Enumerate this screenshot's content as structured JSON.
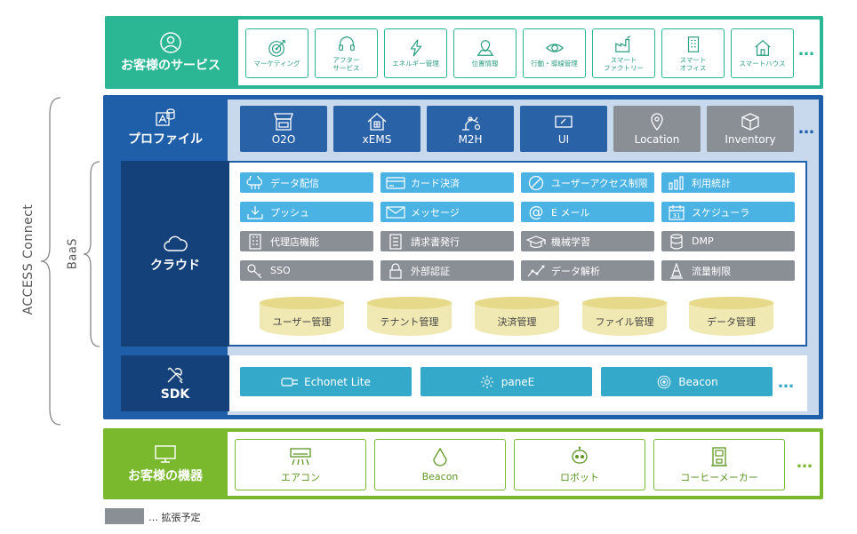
{
  "left_labels": {
    "outer": "ACCESS Connect",
    "inner": "BaaS"
  },
  "services": {
    "title": "お客様のサービス",
    "items": [
      {
        "label": "マーケティング",
        "icon": "target-icon"
      },
      {
        "label": "アフター\nサービス",
        "icon": "headset-icon"
      },
      {
        "label": "エネルギー管理",
        "icon": "bolt-icon"
      },
      {
        "label": "位置情報",
        "icon": "map-pin-icon"
      },
      {
        "label": "行動・導線管理",
        "icon": "eye-icon"
      },
      {
        "label": "スマート\nファクトリー",
        "icon": "factory-icon"
      },
      {
        "label": "スマート\nオフィス",
        "icon": "building-icon"
      },
      {
        "label": "スマートハウス",
        "icon": "house-icon"
      }
    ],
    "more": "…"
  },
  "profile": {
    "title": "プロファイル",
    "items": [
      {
        "label": "O2O",
        "icon": "store-icon",
        "planned": false
      },
      {
        "label": "xEMS",
        "icon": "home-energy-icon",
        "planned": false
      },
      {
        "label": "M2H",
        "icon": "robot-arm-icon",
        "planned": false
      },
      {
        "label": "UI",
        "icon": "ui-panel-icon",
        "planned": false
      },
      {
        "label": "Location",
        "icon": "location-icon",
        "planned": true
      },
      {
        "label": "Inventory",
        "icon": "box-icon",
        "planned": true
      }
    ],
    "more": "…"
  },
  "cloud": {
    "title": "クラウド",
    "features": [
      {
        "label": "データ配信",
        "icon": "cloud-share-icon",
        "planned": false
      },
      {
        "label": "カード決済",
        "icon": "credit-card-icon",
        "planned": false
      },
      {
        "label": "ユーザーアクセス制限",
        "icon": "block-icon",
        "planned": false
      },
      {
        "label": "利用統計",
        "icon": "bar-chart-icon",
        "planned": false
      },
      {
        "label": "プッシュ",
        "icon": "download-icon",
        "planned": false
      },
      {
        "label": "メッセージ",
        "icon": "envelope-icon",
        "planned": false
      },
      {
        "label": "E メール",
        "icon": "at-icon",
        "planned": false
      },
      {
        "label": "スケジューラ",
        "icon": "calendar-icon",
        "planned": false
      },
      {
        "label": "代理店機能",
        "icon": "office-icon",
        "planned": true
      },
      {
        "label": "請求書発行",
        "icon": "document-icon",
        "planned": true
      },
      {
        "label": "機械学習",
        "icon": "graduation-cap-icon",
        "planned": true
      },
      {
        "label": "DMP",
        "icon": "database-icon",
        "planned": true
      },
      {
        "label": "SSO",
        "icon": "key-icon",
        "planned": true
      },
      {
        "label": "外部認証",
        "icon": "lock-icon",
        "planned": true
      },
      {
        "label": "データ解析",
        "icon": "line-chart-icon",
        "planned": true
      },
      {
        "label": "流量制限",
        "icon": "cone-icon",
        "planned": true
      }
    ],
    "databases": [
      "ユーザー管理",
      "テナント管理",
      "決済管理",
      "ファイル管理",
      "データ管理"
    ]
  },
  "sdk": {
    "title": "SDK",
    "items": [
      {
        "label": "Echonet Lite",
        "icon": "plug-icon"
      },
      {
        "label": "paneE",
        "icon": "gear-icon"
      },
      {
        "label": "Beacon",
        "icon": "signal-icon"
      }
    ],
    "more": "…"
  },
  "devices": {
    "title": "お客様の機器",
    "items": [
      {
        "label": "エアコン",
        "icon": "air-conditioner-icon"
      },
      {
        "label": "Beacon",
        "icon": "beacon-drop-icon"
      },
      {
        "label": "ロボット",
        "icon": "robot-icon"
      },
      {
        "label": "コーヒーメーカー",
        "icon": "coffee-maker-icon"
      }
    ],
    "more": "…"
  },
  "legend": {
    "text": "… 拡張予定"
  },
  "colors": {
    "services": "#2bb794",
    "baas": "#1f5fa9",
    "cloud_head": "#15417a",
    "feature_active": "#4bb3e3",
    "planned_gray": "#8a8f96",
    "sdk_button": "#35a9c9",
    "devices": "#7ab92e",
    "database": "#f1e9b3"
  }
}
